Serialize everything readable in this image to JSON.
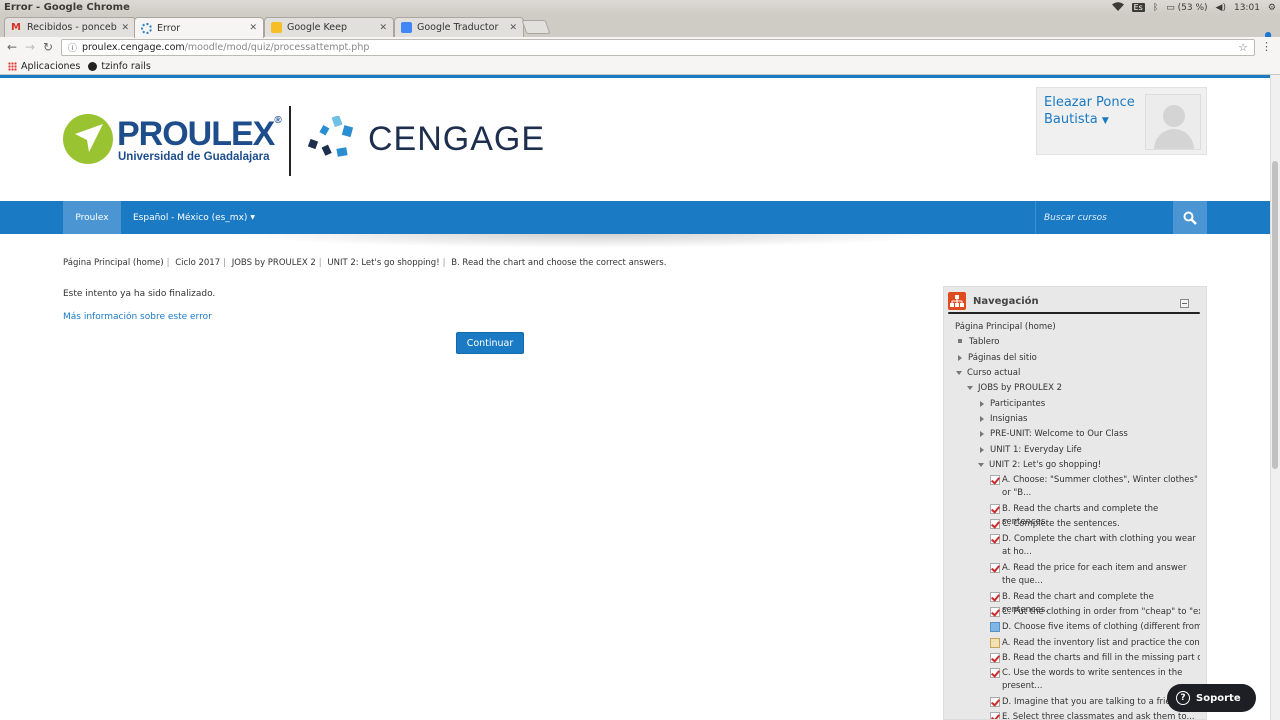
{
  "window": {
    "title": "Error - Google Chrome"
  },
  "tray": {
    "keyboard": "Es",
    "battery": "(53 %)",
    "time": "13:01"
  },
  "tabs": [
    {
      "label": "Recibidos - poncebe",
      "icon": "gmail-icon"
    },
    {
      "label": "Error",
      "icon": "loading-icon"
    },
    {
      "label": "Google Keep",
      "icon": "keep-icon"
    },
    {
      "label": "Google Traductor",
      "icon": "translate-icon"
    }
  ],
  "omnibox": {
    "host": "proulex.cengage.com",
    "path": "/moodle/mod/quiz/processattempt.php"
  },
  "bookmarks": {
    "apps": "Aplicaciones",
    "item1": "tzinfo rails"
  },
  "header": {
    "proulex_name": "PROULEX",
    "proulex_reg": "®",
    "proulex_sub": "Universidad de Guadalajara",
    "cengage_name": "CENGAGE",
    "user_name": "Eleazar Ponce Bautista"
  },
  "navbar": {
    "home": "Proulex",
    "language": "Español - México (es_mx)",
    "search_placeholder": "Buscar cursos"
  },
  "breadcrumb": [
    "Página Principal (home)",
    "Ciclo 2017",
    "JOBS by PROULEX 2",
    "UNIT 2: Let's go shopping!",
    "B. Read the chart and choose the correct answers."
  ],
  "main": {
    "message": "Este intento ya ha sido finalizado.",
    "more_info": "Más información sobre este error",
    "continue": "Continuar"
  },
  "navigation": {
    "title": "Navegación",
    "home": "Página Principal (home)",
    "tablero": "Tablero",
    "paginas": "Páginas del sitio",
    "curso_actual": "Curso actual",
    "course": "JOBS by PROULEX 2",
    "participantes": "Participantes",
    "insignias": "Insignias",
    "preunit": "PRE-UNIT: Welcome to Our Class",
    "unit1": "UNIT 1: Everyday Life",
    "unit2": "UNIT 2: Let's go shopping!",
    "activities": [
      {
        "text": "A. Choose: \"Summer clothes\", Winter clothes\" or \"B...",
        "type": "quiz"
      },
      {
        "text": "B. Read the charts and complete the sentences.",
        "type": "quiz"
      },
      {
        "text": "C. Complete the sentences.",
        "type": "quiz"
      },
      {
        "text": "D. Complete the chart with clothing you wear at ho...",
        "type": "quiz"
      },
      {
        "text": "A. Read the price for each item and answer the que...",
        "type": "quiz"
      },
      {
        "text": "B. Read the chart and complete the sentences.",
        "type": "quiz"
      },
      {
        "text": "C. Put the clothing in order from \"cheap\" to \"expe...",
        "type": "quiz"
      },
      {
        "text": "D. Choose five items of clothing (different from t...",
        "type": "forum"
      },
      {
        "text": "A. Read the inventory list and practice the conver...",
        "type": "lesson"
      },
      {
        "text": "B. Read the charts and fill in the missing part of...",
        "type": "quiz"
      },
      {
        "text": "C. Use the words to write sentences in the present...",
        "type": "quiz"
      },
      {
        "text": "D. Imagine that you are talking to a friend...",
        "type": "quiz"
      },
      {
        "text": "E. Select three classmates and ask them to...",
        "type": "quiz"
      }
    ]
  },
  "support": {
    "label": "Soporte"
  },
  "colors": {
    "brand_blue": "#1a7ac4",
    "proulex_green": "#9ac331",
    "nav_orange": "#e04a1f"
  }
}
